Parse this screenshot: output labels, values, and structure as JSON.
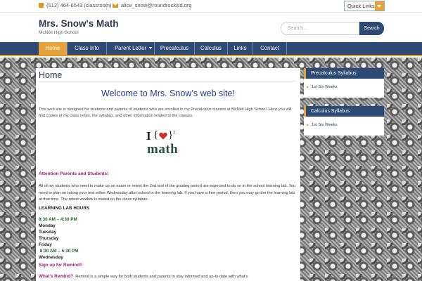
{
  "topbar": {
    "phone": "(512) 464-6543 (classroom)",
    "email": "alice_snow@roundrockisd.org",
    "quick_links": "Quick Links"
  },
  "header": {
    "title": "Mrs. Snow's Math",
    "subtitle": "McNeil High School",
    "search_placeholder": "Search...",
    "search_button": "Search"
  },
  "nav": {
    "items": [
      {
        "label": "Home",
        "active": true
      },
      {
        "label": "Class Info"
      },
      {
        "label": "Parent Letter"
      },
      {
        "label": "Precalculus"
      },
      {
        "label": "Calculus"
      },
      {
        "label": "Links"
      },
      {
        "label": "Contact"
      }
    ]
  },
  "main": {
    "page_title": "Home",
    "welcome": "Welcome to Mrs. Snow’s web site!",
    "intro": "This web site is designed for students and parents of students who are enrolled in my Precalculus classes at McNeil High School.   Here you will find copies of my class notes, the syllabus, and other information related to the classes.",
    "logo": {
      "i": "I",
      "open_brace": "{",
      "close_brace": "}",
      "exponent": "2",
      "word": "math"
    },
    "attention": "Attention Parents and Students!",
    "paragraph": "  All of my students who need to make up an exam or retest the 2nd test of the grading period are expected to do so in the school learning lab.  You need to plan on taking your test either Wednesday after school in the learning lab.  If you have a free period, then you may go the the learning lab at that time.  The retest window is stated on the class syllabus.",
    "lab_hours": "LEARNING LAB HOURS",
    "schedule": [
      "8:30 AM – 4:30 PM",
      "Monday",
      "Tuesday",
      "Thursday",
      "Friday",
      " 8:30 AM – 5:30 PM",
      "Wednesday"
    ],
    "signup": "Sign up for Remind!!",
    "remind_label": "What’s Remind?",
    "remind_text": "  Remind is a simple way for both students and parents to stay informed and up-to-date with what’s"
  },
  "sidebar": {
    "widgets": [
      {
        "title": "Precalculus Syllabus",
        "link": "1st Six Weeks"
      },
      {
        "title": "Calculus Syllabus",
        "link": "1st Six Weeks"
      }
    ]
  },
  "colors": {
    "navy": "#2c4a74",
    "orange": "#e8a23a",
    "welcome_blue": "#233a8c",
    "magenta": "#9b1f6a",
    "green": "#1d6a2c"
  }
}
